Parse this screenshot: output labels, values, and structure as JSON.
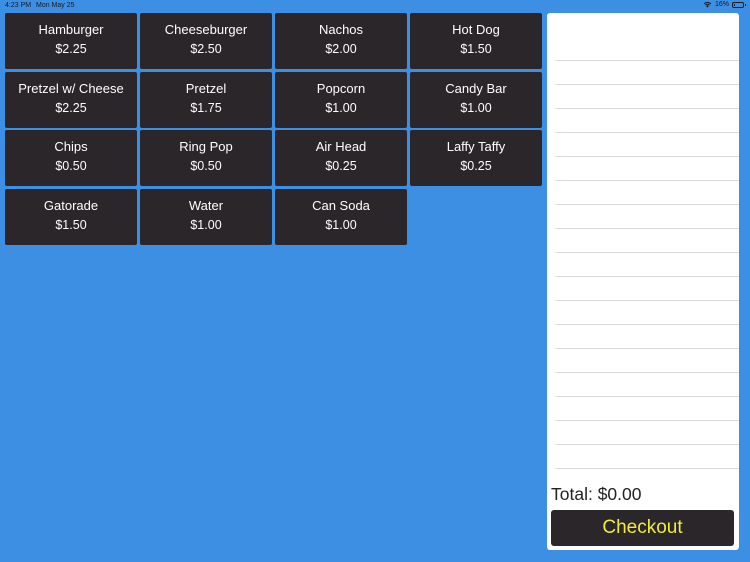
{
  "status_bar": {
    "time": "4:23 PM",
    "date": "Mon May 25",
    "battery_text": "16%",
    "battery_level": 0.16
  },
  "menu": {
    "items": [
      {
        "name": "Hamburger",
        "price": "$2.25"
      },
      {
        "name": "Cheeseburger",
        "price": "$2.50"
      },
      {
        "name": "Nachos",
        "price": "$2.00"
      },
      {
        "name": "Hot Dog",
        "price": "$1.50"
      },
      {
        "name": "Pretzel w/ Cheese",
        "price": "$2.25"
      },
      {
        "name": "Pretzel",
        "price": "$1.75"
      },
      {
        "name": "Popcorn",
        "price": "$1.00"
      },
      {
        "name": "Candy Bar",
        "price": "$1.00"
      },
      {
        "name": "Chips",
        "price": "$0.50"
      },
      {
        "name": "Ring Pop",
        "price": "$0.50"
      },
      {
        "name": "Air Head",
        "price": "$0.25"
      },
      {
        "name": "Laffy Taffy",
        "price": "$0.25"
      },
      {
        "name": "Gatorade",
        "price": "$1.50"
      },
      {
        "name": "Water",
        "price": "$1.00"
      },
      {
        "name": "Can Soda",
        "price": "$1.00"
      }
    ]
  },
  "order": {
    "total_label": "Total: $0.00",
    "checkout_label": "Checkout"
  },
  "colors": {
    "background": "#3d8fe4",
    "button": "#2a2629",
    "button_text": "#ffffff",
    "checkout_text": "#f1ec3a"
  }
}
